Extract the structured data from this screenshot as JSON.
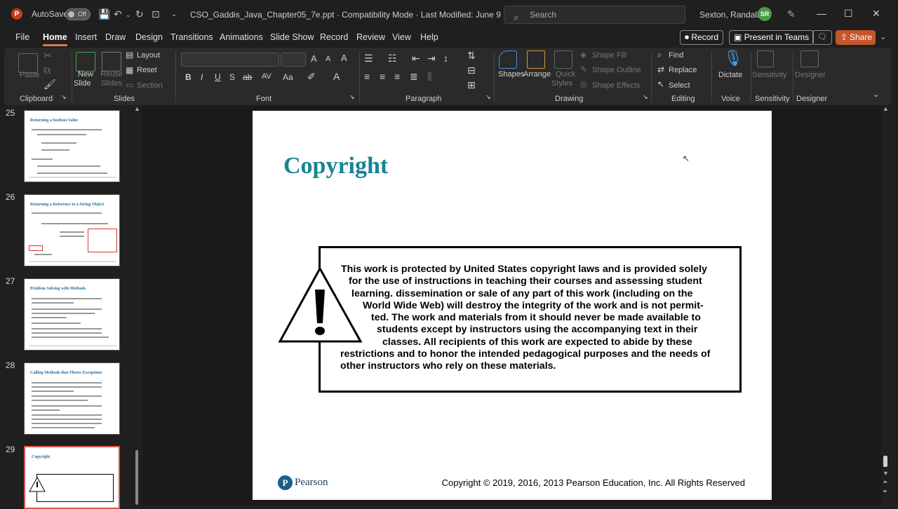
{
  "titlebar": {
    "app_letter": "P",
    "autosave_label": "AutoSave",
    "autosave_state": "Off",
    "document_title": "CSO_Gaddis_Java_Chapter05_7e.ppt  ·  Compatibility Mode  ·  Last Modified: June 9",
    "search_placeholder": "Search",
    "user_name": "Sexton, Randall S",
    "user_initials": "SR"
  },
  "menu": {
    "items": [
      "File",
      "Home",
      "Insert",
      "Draw",
      "Design",
      "Transitions",
      "Animations",
      "Slide Show",
      "Record",
      "Review",
      "View",
      "Help"
    ],
    "active": "Home",
    "record_label": "Record",
    "teams_label": "Present in Teams",
    "share_label": "Share"
  },
  "ribbon": {
    "clipboard": {
      "paste": "Paste",
      "group": "Clipboard"
    },
    "slides": {
      "new_slide": "New",
      "new_slide2": "Slide",
      "reuse": "Reuse",
      "reuse2": "Slides",
      "layout": "Layout",
      "reset": "Reset",
      "section": "Section",
      "group": "Slides"
    },
    "font": {
      "group": "Font"
    },
    "paragraph": {
      "group": "Paragraph"
    },
    "drawing": {
      "shapes": "Shapes",
      "arrange": "Arrange",
      "quick_styles": "Quick",
      "quick_styles2": "Styles",
      "shape_fill": "Shape Fill",
      "shape_outline": "Shape Outline",
      "shape_effects": "Shape Effects",
      "group": "Drawing"
    },
    "editing": {
      "find": "Find",
      "replace": "Replace",
      "select": "Select",
      "group": "Editing"
    },
    "voice": {
      "dictate": "Dictate",
      "group": "Voice"
    },
    "sensitivity": {
      "label": "Sensitivity",
      "group": "Sensitivity"
    },
    "designer": {
      "label": "Designer",
      "group": "Designer"
    }
  },
  "thumbnails": [
    {
      "number": "25",
      "title": "Returning a boolean Value"
    },
    {
      "number": "26",
      "title": "Returning a Reference to a String Object"
    },
    {
      "number": "27",
      "title": "Problem Solving with Methods"
    },
    {
      "number": "28",
      "title": "Calling Methods that Throw Exceptions"
    },
    {
      "number": "29",
      "title": "Copyright"
    }
  ],
  "slide": {
    "title": "Copyright",
    "warning_lines": [
      "This work is protected by United States copyright laws and is provided solely",
      "for the use of instructions in teaching their courses and assessing student",
      "learning. dissemination or sale of any part of this work (including on the",
      "World Wide Web) will destroy the integrity of the work and is not permit-",
      "ted. The work and materials from it should never be made available to",
      "students except by instructors using the accompanying text in their",
      "classes. All recipients of this work are expected to abide by these",
      "restrictions and to honor the intended pedagogical purposes and the needs of",
      "other instructors who rely on these materials."
    ],
    "brand": "Pearson",
    "footer": "Copyright © 2019, 2016, 2013 Pearson Education, Inc. All Rights Reserved"
  }
}
